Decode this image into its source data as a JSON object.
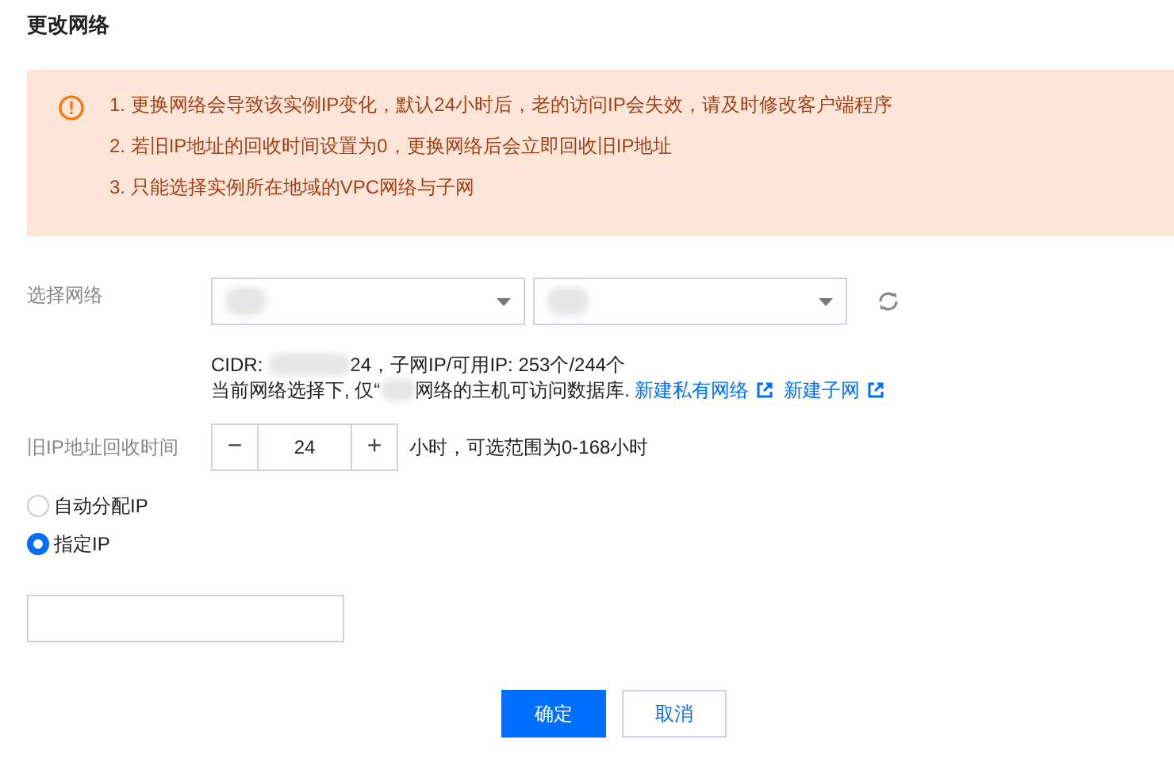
{
  "title": "更改网络",
  "alert": {
    "items": [
      "1. 更换网络会导致该实例IP变化，默认24小时后，老的访问IP会失效，请及时修改客户端程序",
      "2. 若旧IP地址的回收时间设置为0，更换网络后会立即回收旧IP地址",
      "3. 只能选择实例所在地域的VPC网络与子网"
    ]
  },
  "network": {
    "label": "选择网络",
    "cidr_prefix": "CIDR:",
    "cidr_suffix": "24，子网IP/可用IP: 253个/244个",
    "note_prefix": "当前网络选择下, 仅“",
    "note_suffix": "网络的主机可访问数据库.",
    "links": [
      "新建私有网络",
      "新建子网"
    ]
  },
  "recycle": {
    "label": "旧IP地址回收时间",
    "minus": "−",
    "value": "24",
    "plus": "+",
    "hint": "小时，可选范围为0-168小时"
  },
  "ip_mode": [
    {
      "label": "自动分配IP",
      "selected": false
    },
    {
      "label": "指定IP",
      "selected": true
    }
  ],
  "buttons": [
    {
      "label": "确定",
      "kind": "primary"
    },
    {
      "label": "取消",
      "kind": "secondary"
    }
  ]
}
